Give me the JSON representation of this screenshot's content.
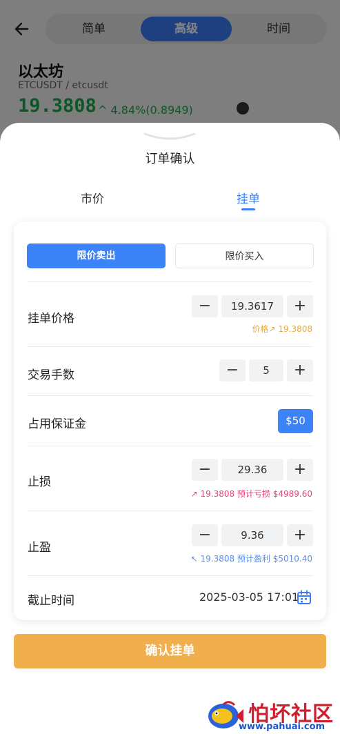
{
  "header": {
    "tabs": [
      "简单",
      "高级",
      "时间"
    ],
    "active_tab": 1
  },
  "coin": {
    "name": "以太坊",
    "pair": "ETCUSDT / etcusdt",
    "price": "19.3808",
    "change": "^ 4.84%(0.8949)"
  },
  "sheet": {
    "title": "订单确认",
    "tabs": [
      "市价",
      "挂单"
    ],
    "active_tab": 1
  },
  "order": {
    "sell_label": "限价卖出",
    "buy_label": "限价买入",
    "limit_price": {
      "label": "挂单价格",
      "value": "19.3617",
      "hint": "价格↗ 19.3808"
    },
    "lots": {
      "label": "交易手数",
      "value": "5"
    },
    "margin": {
      "label": "占用保证金",
      "value": "$50"
    },
    "stop_loss": {
      "label": "止损",
      "value": "29.36",
      "hint": "↗ 19.3808 预计亏损 $4989.60"
    },
    "take_profit": {
      "label": "止盈",
      "value": "9.36",
      "hint": "↖ 19.3808 预计盈利 $5010.40"
    },
    "deadline": {
      "label": "截止时间",
      "value": "2025-03-05 17:01"
    }
  },
  "confirm_label": "确认挂单",
  "watermark": {
    "title": "怕坏社区",
    "url": "www.pahuai.com"
  },
  "colors": {
    "accent": "#3b7cf6",
    "price_up": "#1aa84a",
    "confirm": "#f0ae4d",
    "loss": "#e0457b",
    "profit": "#5a8ee8",
    "hint_gold": "#e8a93b"
  }
}
